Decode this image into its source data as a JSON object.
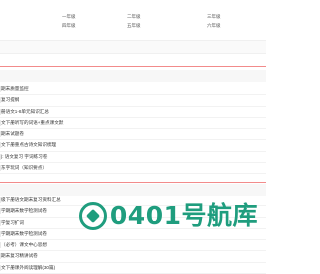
{
  "grades": [
    {
      "label": "一年级"
    },
    {
      "label": "二年级"
    },
    {
      "label": "三年级"
    },
    {
      "label": "四年级"
    },
    {
      "label": "五年级"
    },
    {
      "label": "六年级"
    }
  ],
  "list_top": [
    "期末质量监控",
    "复习提纲",
    "册语文1-8单元知识汇总",
    "文下册听写的词语+重点课文默",
    "期末试题卷",
    "文下册重点古诗文知识梳理",
    "|: 语文复习 字词练习卷",
    "东字玩词（知识要点）"
  ],
  "list_bottom": [
    "级下册语文期末复习资料汇总",
    "学期期末数学检测试卷",
    "学复习扩词",
    "学期期末数学检测试卷",
    "（必考）课文中心思想",
    "期末复习精讲试卷",
    "文下册课外阅读理解(30篇)"
  ],
  "watermark": {
    "text": "0401号航库",
    "icon": "logo-icon"
  },
  "colors": {
    "accent_red": "#f28b8b",
    "brand_green": "#1f9d7e"
  }
}
